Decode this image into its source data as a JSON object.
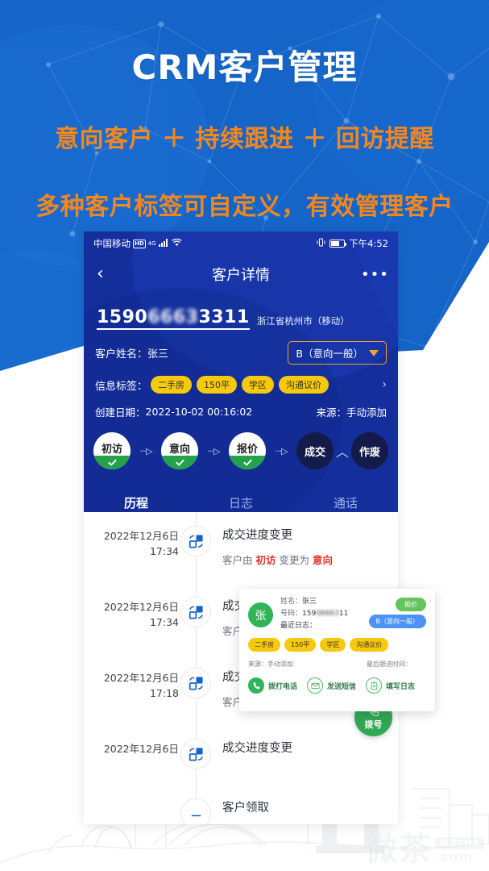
{
  "hero": {
    "title": "CRM客户管理",
    "subtitle1": "意向客户 ＋ 持续跟进 ＋ 回访提醒",
    "subtitle2": "多种客户标签可自定义，有效管理客户"
  },
  "phone": {
    "status_bar": {
      "carrier": "中国移动",
      "hd_badge": "HD",
      "network": "4G",
      "time": "下午4:52"
    },
    "nav": {
      "back_icon": "chevron-left-icon",
      "title": "客户详情",
      "more_icon": "ellipsis-icon"
    },
    "customer": {
      "phone_prefix": "1590",
      "phone_masked": "6663",
      "phone_suffix": "3311",
      "phone_full": "15906663 3311",
      "location": "浙江省杭州市（移动）",
      "name_label": "客户姓名：",
      "name_value": "张三",
      "grade": "B（意向一般）",
      "tags_label": "信息标签：",
      "tags": [
        "二手房",
        "150平",
        "学区",
        "沟通议价"
      ],
      "created_label": "创建日期：",
      "created_value": "2022-10-02 00:16:02",
      "source_label": "来源：",
      "source_value": "手动添加"
    },
    "steps": [
      {
        "label": "初访",
        "done": true
      },
      {
        "label": "意向",
        "done": true
      },
      {
        "label": "报价",
        "done": true
      },
      {
        "label": "成交",
        "done": false
      },
      {
        "label": "作废",
        "done": false
      }
    ],
    "tabs": [
      {
        "label": "历程",
        "active": true
      },
      {
        "label": "日志",
        "active": false
      },
      {
        "label": "通话",
        "active": false
      }
    ],
    "timeline": [
      {
        "date": "2022年12月6日",
        "time": "17:34",
        "icon": "progress-change-icon",
        "title": "成交进度变更",
        "desc_prefix": "客户由 ",
        "desc_from": "初访",
        "desc_mid": " 变更为 ",
        "desc_to": "意向"
      },
      {
        "date": "2022年12月6日",
        "time": "17:34",
        "icon": "progress-change-icon",
        "title": "成交进度变更",
        "desc_prefix": "客户由 ",
        "desc_from": "",
        "desc_mid": "",
        "desc_to": ""
      },
      {
        "date": "2022年12月6日",
        "time": "17:18",
        "icon": "progress-change-icon",
        "title": "成交进度变更",
        "desc_prefix": "客户由 ",
        "desc_from": "",
        "desc_mid": "",
        "desc_to": ""
      },
      {
        "date": "2022年12月6日",
        "time": "",
        "icon": "progress-change-icon",
        "title": "成交进度变更",
        "desc_prefix": "",
        "desc_from": "",
        "desc_mid": "",
        "desc_to": ""
      },
      {
        "date": "",
        "time": "",
        "icon": "receive-icon",
        "title": "客户领取",
        "desc_prefix": "",
        "desc_from": "",
        "desc_mid": "",
        "desc_to": ""
      }
    ]
  },
  "float_card": {
    "avatar_initial": "张",
    "name_label": "姓名：",
    "name_value": "张三",
    "number_label": "号码：",
    "number_prefix": "159",
    "number_masked": "06663",
    "number_suffix": "11",
    "recent_log_label": "最近日志：",
    "badge_stage": "报价",
    "badge_grade": "B（意向一般）",
    "chevron": "›",
    "tags": [
      "二手房",
      "150平",
      "学区",
      "沟通议价"
    ],
    "source_label": "来源：",
    "source_value": "手动添加",
    "last_follow_label": "最后跟进时间：",
    "actions": [
      {
        "label": "拨打电话",
        "icon": "phone-icon"
      },
      {
        "label": "发送短信",
        "icon": "message-icon"
      },
      {
        "label": "填写日志",
        "icon": "clipboard-icon"
      }
    ]
  },
  "fab": {
    "label": "拨号",
    "icon": "dial-phone-icon"
  },
  "watermark": {
    "cn": "微茶",
    "tag": "WXCHA",
    "com": ".com"
  },
  "colors": {
    "banner_blue": "#1565c8",
    "app_navy": "#142f9c",
    "orange": "#f4861e",
    "tag_yellow": "#f6c90c",
    "green": "#24a24a",
    "red": "#e1352c"
  }
}
